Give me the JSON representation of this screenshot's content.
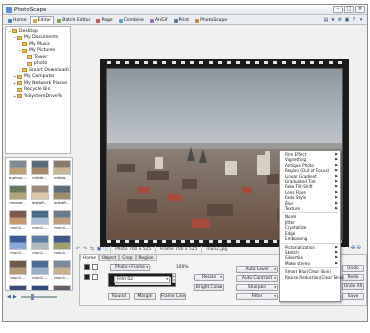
{
  "window": {
    "title": "PhotoScape"
  },
  "tabs": [
    {
      "label": "Home",
      "color": "#4a7bc8"
    },
    {
      "label": "Editor",
      "color": "#d9a33a"
    },
    {
      "label": "Batch Editor",
      "color": "#7aa84a"
    },
    {
      "label": "Page",
      "color": "#c55a5a"
    },
    {
      "label": "Combine",
      "color": "#5aa0c5"
    },
    {
      "label": "AnGif",
      "color": "#9a6ac0"
    },
    {
      "label": "Print",
      "color": "#5a7a9a"
    },
    {
      "label": "PhotoScape",
      "color": "#c08a3a"
    }
  ],
  "tree": [
    {
      "label": "Desktop",
      "indent": 0,
      "exp": "−"
    },
    {
      "label": "My Documents",
      "indent": 1,
      "exp": "−"
    },
    {
      "label": "My Music",
      "indent": 2,
      "exp": ""
    },
    {
      "label": "My Pictures",
      "indent": 2,
      "exp": "−"
    },
    {
      "label": "Tower",
      "indent": 3,
      "exp": ""
    },
    {
      "label": "photo",
      "indent": 3,
      "exp": ""
    },
    {
      "label": "Smart Downloads",
      "indent": 2,
      "exp": ""
    },
    {
      "label": "My Computer",
      "indent": 1,
      "exp": "+"
    },
    {
      "label": "My Network Places",
      "indent": 1,
      "exp": "+"
    },
    {
      "label": "Recycle Bin",
      "indent": 1,
      "exp": ""
    },
    {
      "label": "%SystemDrive%",
      "indent": 1,
      "exp": "+"
    }
  ],
  "thumbnails": [
    {
      "label": "mpluss...",
      "c1": "#7f8a92",
      "c2": "#b9a27a"
    },
    {
      "label": "m0da...",
      "c1": "#5a6b7a",
      "c2": "#a58a6a"
    },
    {
      "label": "mfoto...",
      "c1": "#8a7a6a",
      "c2": "#c9b69a"
    },
    {
      "label": "mnose...",
      "c1": "#6a7a5a",
      "c2": "#b5a37f"
    },
    {
      "label": "mstaff...",
      "c1": "#9a8a7a",
      "c2": "#d9c9aa"
    },
    {
      "label": "mstaff...",
      "c1": "#5c6c7c",
      "c2": "#9c8c6c"
    },
    {
      "label": "mun1...",
      "c1": "#7a5a4a",
      "c2": "#c9956a"
    },
    {
      "label": "mun1...",
      "c1": "#4a6a8a",
      "c2": "#aac0d8"
    },
    {
      "label": "mun1...",
      "c1": "#6a7a8a",
      "c2": "#c0a080"
    },
    {
      "label": "mun1...",
      "c1": "#3a5a9a",
      "c2": "#8aa8d8"
    },
    {
      "label": "mun1...",
      "c1": "#5a7aa0",
      "c2": "#b0b8c0"
    },
    {
      "label": "mun1...",
      "c1": "#3d5a8a",
      "c2": "#a0a070"
    },
    {
      "label": "mun1...",
      "c1": "#6a5a4a",
      "c2": "#b59a7a"
    },
    {
      "label": "mun1...",
      "c1": "#4a6a9a",
      "c2": "#9ab0c8"
    },
    {
      "label": "mun1...",
      "c1": "#7a8a9a",
      "c2": "#c8b090"
    },
    {
      "label": "mun1...",
      "c1": "#3a4a7a",
      "c2": "#8a9ac0"
    },
    {
      "label": "mun1...",
      "c1": "#2d4d7d",
      "c2": "#6a8ab5"
    },
    {
      "label": "mun1...",
      "c1": "#6a5a6a",
      "c2": "#b8a8a0"
    }
  ],
  "context_menu": [
    {
      "label": "Film Effect",
      "sub": true
    },
    {
      "label": "Vignetting",
      "sub": true
    },
    {
      "label": "Antique Photo",
      "sub": true
    },
    {
      "label": "Region (Out of Focus)",
      "sub": true
    },
    {
      "label": "Linear Gradient",
      "sub": true
    },
    {
      "label": "Graduated Tint",
      "sub": true
    },
    {
      "label": "Fake Tilt-Shift",
      "sub": true
    },
    {
      "label": "Lens Flare",
      "sub": true
    },
    {
      "label": "Fade Style",
      "sub": true
    },
    {
      "label": "Blur",
      "sub": true
    },
    {
      "label": "Texture",
      "sub": true
    },
    {
      "sep": true
    },
    {
      "label": "Noise",
      "sub": false
    },
    {
      "label": "Jitter",
      "sub": false
    },
    {
      "label": "Crystallize",
      "sub": false
    },
    {
      "label": "Edge",
      "sub": false
    },
    {
      "label": "Embossing",
      "sub": false
    },
    {
      "sep": true
    },
    {
      "label": "Pictorialization",
      "sub": true
    },
    {
      "label": "Sketch",
      "sub": true
    },
    {
      "label": "Silvertile",
      "sub": true
    },
    {
      "label": "Make stereo",
      "sub": true
    },
    {
      "sep": true
    },
    {
      "label": "Smart Blur(Clear Skin)",
      "sub": false
    },
    {
      "label": "Resize Reduction(Clear Skin)",
      "sub": false
    }
  ],
  "status": {
    "photo_size": "Photo 700 x 525",
    "frame_size": "Frame 700 x 525",
    "filename": "mun2.jpg"
  },
  "editor": {
    "subtabs": [
      "Home",
      "Object",
      "Crop",
      "Region"
    ],
    "photo_frame_btn": "Photo+Frame",
    "zoom_pct": "100%",
    "frame_select": "Film 02",
    "round_btn": "Round",
    "margin_btn": "Margin",
    "frame_line_btn": "Frame Line",
    "resize_btn": "Resize",
    "bright_color_btn": "Bright,Color",
    "auto_level_btn": "Auto Level",
    "auto_contrast_btn": "Auto Contrast",
    "sharpen_btn": "Sharpen",
    "filter_btn": "Filter",
    "undo_btn": "Undo",
    "redo_btn": "Redo",
    "undo_all_btn": "Undo All",
    "save_btn": "Save"
  }
}
